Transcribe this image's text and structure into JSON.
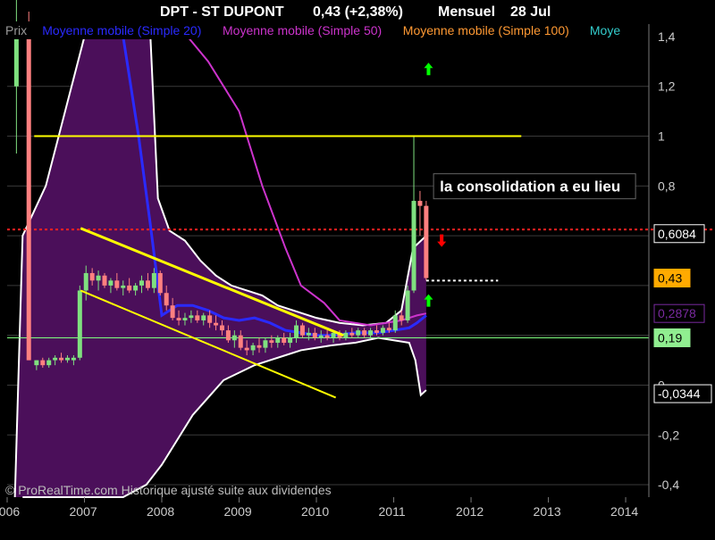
{
  "header": {
    "ticker": "DPT - ST DUPONT",
    "change": "0,43 (+2,38%)",
    "period": "Mensuel",
    "date": "28 Jul"
  },
  "legend": [
    {
      "label": "Prix",
      "color": "#9a9a9a"
    },
    {
      "label": "Moyenne mobile (Simple 20)",
      "color": "#2a2aff"
    },
    {
      "label": "Moyenne mobile (Simple 50)",
      "color": "#cc33cc"
    },
    {
      "label": "Moyenne mobile (Simple 100)",
      "color": "#ff9933"
    },
    {
      "label": "Moye",
      "color": "#33cccc"
    }
  ],
  "annotation": "la consolidation a eu lieu",
  "watermark": "© ProRealTime.com Historique ajusté suite aux dividendes",
  "price_tags": [
    {
      "text": "0,6084",
      "value": 0.6084,
      "bg": "#000000",
      "fg": "#ffffff",
      "border": "#ffffff"
    },
    {
      "text": "0,43",
      "value": 0.43,
      "bg": "#ffaa00",
      "fg": "#000000",
      "border": "#ffaa00"
    },
    {
      "text": "0,2878",
      "value": 0.2878,
      "bg": "#000000",
      "fg": "#7a2aa0",
      "border": "#7a2aa0"
    },
    {
      "text": "0,19",
      "value": 0.19,
      "bg": "#90ee90",
      "fg": "#000000",
      "border": "#90ee90"
    },
    {
      "text": "-0,0344",
      "value": -0.0344,
      "bg": "#000000",
      "fg": "#ffffff",
      "border": "#ffffff"
    }
  ],
  "colors": {
    "background": "#000000",
    "band_fill": "#4b0f5a",
    "band_edge": "#ffffff",
    "up_candle": "#7fe07f",
    "down_candle": "#ff8080",
    "trend_line": "#ffff00",
    "resistance": "#ff2020",
    "sma20": "#2a2aff",
    "sma50": "#cc33cc",
    "sma100_zone": "#ffffff",
    "support": "#80ff80",
    "arrow_up": "#00ff00",
    "arrow_down": "#ff0000",
    "axis_text": "#cccccc"
  },
  "chart_data": {
    "type": "candlestick",
    "title": "DPT - ST DUPONT",
    "ylim": [
      -0.45,
      1.45
    ],
    "xlim": [
      2006.0,
      2014.3
    ],
    "y_ticks": [
      {
        "v": 1.4,
        "label": "1,4"
      },
      {
        "v": 1.2,
        "label": "1,2"
      },
      {
        "v": 1.0,
        "label": "1"
      },
      {
        "v": 0.8,
        "label": "0,8"
      },
      {
        "v": 0.6,
        "label": ""
      },
      {
        "v": 0.4,
        "label": ""
      },
      {
        "v": 0.2,
        "label": ""
      },
      {
        "v": 0.0,
        "label": "0"
      },
      {
        "v": -0.2,
        "label": "-0,2"
      },
      {
        "v": -0.4,
        "label": "-0,4"
      }
    ],
    "x_ticks": [
      {
        "v": 2006.0,
        "label": "2006"
      },
      {
        "v": 2007.0,
        "label": "2007"
      },
      {
        "v": 2008.0,
        "label": "2008"
      },
      {
        "v": 2009.0,
        "label": "2009"
      },
      {
        "v": 2010.0,
        "label": "2010"
      },
      {
        "v": 2011.0,
        "label": "2011"
      },
      {
        "v": 2012.0,
        "label": "2012"
      },
      {
        "v": 2013.0,
        "label": "2013"
      },
      {
        "v": 2014.0,
        "label": "2014"
      }
    ],
    "candles": [
      {
        "x": 2006.12,
        "o": 1.2,
        "h": 1.7,
        "l": 0.93,
        "c": 1.45
      },
      {
        "x": 2006.28,
        "o": 1.4,
        "h": 1.5,
        "l": 0.1,
        "c": 0.1
      },
      {
        "x": 2006.38,
        "o": 0.08,
        "h": 0.1,
        "l": 0.06,
        "c": 0.1
      },
      {
        "x": 2006.46,
        "o": 0.1,
        "h": 0.11,
        "l": 0.07,
        "c": 0.08
      },
      {
        "x": 2006.54,
        "o": 0.08,
        "h": 0.11,
        "l": 0.07,
        "c": 0.1
      },
      {
        "x": 2006.62,
        "o": 0.1,
        "h": 0.12,
        "l": 0.08,
        "c": 0.11
      },
      {
        "x": 2006.7,
        "o": 0.11,
        "h": 0.13,
        "l": 0.09,
        "c": 0.1
      },
      {
        "x": 2006.78,
        "o": 0.1,
        "h": 0.12,
        "l": 0.09,
        "c": 0.11
      },
      {
        "x": 2006.86,
        "o": 0.1,
        "h": 0.12,
        "l": 0.08,
        "c": 0.11
      },
      {
        "x": 2006.94,
        "o": 0.11,
        "h": 0.4,
        "l": 0.1,
        "c": 0.38
      },
      {
        "x": 2007.02,
        "o": 0.38,
        "h": 0.48,
        "l": 0.34,
        "c": 0.45
      },
      {
        "x": 2007.1,
        "o": 0.45,
        "h": 0.47,
        "l": 0.4,
        "c": 0.42
      },
      {
        "x": 2007.18,
        "o": 0.42,
        "h": 0.46,
        "l": 0.38,
        "c": 0.44
      },
      {
        "x": 2007.26,
        "o": 0.44,
        "h": 0.45,
        "l": 0.39,
        "c": 0.4
      },
      {
        "x": 2007.34,
        "o": 0.4,
        "h": 0.43,
        "l": 0.37,
        "c": 0.42
      },
      {
        "x": 2007.42,
        "o": 0.42,
        "h": 0.45,
        "l": 0.38,
        "c": 0.39
      },
      {
        "x": 2007.5,
        "o": 0.39,
        "h": 0.42,
        "l": 0.36,
        "c": 0.4
      },
      {
        "x": 2007.58,
        "o": 0.4,
        "h": 0.43,
        "l": 0.37,
        "c": 0.38
      },
      {
        "x": 2007.66,
        "o": 0.38,
        "h": 0.41,
        "l": 0.36,
        "c": 0.4
      },
      {
        "x": 2007.74,
        "o": 0.4,
        "h": 0.44,
        "l": 0.37,
        "c": 0.42
      },
      {
        "x": 2007.82,
        "o": 0.42,
        "h": 0.45,
        "l": 0.38,
        "c": 0.39
      },
      {
        "x": 2007.9,
        "o": 0.39,
        "h": 0.47,
        "l": 0.37,
        "c": 0.45
      },
      {
        "x": 2007.98,
        "o": 0.45,
        "h": 0.46,
        "l": 0.36,
        "c": 0.37
      },
      {
        "x": 2008.06,
        "o": 0.37,
        "h": 0.4,
        "l": 0.3,
        "c": 0.32
      },
      {
        "x": 2008.14,
        "o": 0.32,
        "h": 0.35,
        "l": 0.26,
        "c": 0.27
      },
      {
        "x": 2008.22,
        "o": 0.27,
        "h": 0.3,
        "l": 0.24,
        "c": 0.26
      },
      {
        "x": 2008.3,
        "o": 0.26,
        "h": 0.29,
        "l": 0.24,
        "c": 0.27
      },
      {
        "x": 2008.38,
        "o": 0.27,
        "h": 0.3,
        "l": 0.25,
        "c": 0.28
      },
      {
        "x": 2008.46,
        "o": 0.28,
        "h": 0.3,
        "l": 0.25,
        "c": 0.26
      },
      {
        "x": 2008.54,
        "o": 0.26,
        "h": 0.29,
        "l": 0.24,
        "c": 0.28
      },
      {
        "x": 2008.62,
        "o": 0.28,
        "h": 0.3,
        "l": 0.23,
        "c": 0.25
      },
      {
        "x": 2008.7,
        "o": 0.25,
        "h": 0.28,
        "l": 0.22,
        "c": 0.24
      },
      {
        "x": 2008.78,
        "o": 0.24,
        "h": 0.26,
        "l": 0.2,
        "c": 0.22
      },
      {
        "x": 2008.86,
        "o": 0.22,
        "h": 0.24,
        "l": 0.17,
        "c": 0.18
      },
      {
        "x": 2008.94,
        "o": 0.18,
        "h": 0.22,
        "l": 0.15,
        "c": 0.2
      },
      {
        "x": 2009.02,
        "o": 0.2,
        "h": 0.22,
        "l": 0.14,
        "c": 0.15
      },
      {
        "x": 2009.1,
        "o": 0.15,
        "h": 0.18,
        "l": 0.12,
        "c": 0.14
      },
      {
        "x": 2009.18,
        "o": 0.14,
        "h": 0.17,
        "l": 0.12,
        "c": 0.16
      },
      {
        "x": 2009.26,
        "o": 0.16,
        "h": 0.19,
        "l": 0.13,
        "c": 0.15
      },
      {
        "x": 2009.34,
        "o": 0.15,
        "h": 0.19,
        "l": 0.13,
        "c": 0.18
      },
      {
        "x": 2009.42,
        "o": 0.18,
        "h": 0.2,
        "l": 0.15,
        "c": 0.17
      },
      {
        "x": 2009.5,
        "o": 0.17,
        "h": 0.2,
        "l": 0.15,
        "c": 0.19
      },
      {
        "x": 2009.58,
        "o": 0.19,
        "h": 0.21,
        "l": 0.16,
        "c": 0.17
      },
      {
        "x": 2009.66,
        "o": 0.17,
        "h": 0.21,
        "l": 0.15,
        "c": 0.19
      },
      {
        "x": 2009.74,
        "o": 0.19,
        "h": 0.26,
        "l": 0.17,
        "c": 0.24
      },
      {
        "x": 2009.82,
        "o": 0.24,
        "h": 0.25,
        "l": 0.19,
        "c": 0.2
      },
      {
        "x": 2009.9,
        "o": 0.2,
        "h": 0.23,
        "l": 0.18,
        "c": 0.21
      },
      {
        "x": 2009.98,
        "o": 0.21,
        "h": 0.23,
        "l": 0.18,
        "c": 0.19
      },
      {
        "x": 2010.06,
        "o": 0.19,
        "h": 0.22,
        "l": 0.17,
        "c": 0.2
      },
      {
        "x": 2010.14,
        "o": 0.2,
        "h": 0.22,
        "l": 0.18,
        "c": 0.19
      },
      {
        "x": 2010.22,
        "o": 0.19,
        "h": 0.22,
        "l": 0.17,
        "c": 0.21
      },
      {
        "x": 2010.3,
        "o": 0.21,
        "h": 0.22,
        "l": 0.18,
        "c": 0.19
      },
      {
        "x": 2010.38,
        "o": 0.19,
        "h": 0.22,
        "l": 0.18,
        "c": 0.21
      },
      {
        "x": 2010.46,
        "o": 0.21,
        "h": 0.23,
        "l": 0.19,
        "c": 0.2
      },
      {
        "x": 2010.54,
        "o": 0.2,
        "h": 0.23,
        "l": 0.19,
        "c": 0.22
      },
      {
        "x": 2010.62,
        "o": 0.22,
        "h": 0.23,
        "l": 0.19,
        "c": 0.2
      },
      {
        "x": 2010.7,
        "o": 0.2,
        "h": 0.23,
        "l": 0.19,
        "c": 0.22
      },
      {
        "x": 2010.78,
        "o": 0.22,
        "h": 0.24,
        "l": 0.2,
        "c": 0.21
      },
      {
        "x": 2010.86,
        "o": 0.21,
        "h": 0.24,
        "l": 0.2,
        "c": 0.23
      },
      {
        "x": 2010.94,
        "o": 0.23,
        "h": 0.25,
        "l": 0.21,
        "c": 0.22
      },
      {
        "x": 2011.02,
        "o": 0.22,
        "h": 0.3,
        "l": 0.21,
        "c": 0.28
      },
      {
        "x": 2011.1,
        "o": 0.28,
        "h": 0.3,
        "l": 0.24,
        "c": 0.26
      },
      {
        "x": 2011.18,
        "o": 0.26,
        "h": 0.4,
        "l": 0.25,
        "c": 0.38
      },
      {
        "x": 2011.26,
        "o": 0.38,
        "h": 1.0,
        "l": 0.37,
        "c": 0.74
      },
      {
        "x": 2011.34,
        "o": 0.74,
        "h": 0.78,
        "l": 0.6,
        "c": 0.72
      },
      {
        "x": 2011.42,
        "o": 0.72,
        "h": 0.74,
        "l": 0.42,
        "c": 0.43
      }
    ],
    "sma20": [
      [
        2007.5,
        1.4
      ],
      [
        2007.7,
        1.0
      ],
      [
        2007.85,
        0.65
      ],
      [
        2008.0,
        0.28
      ],
      [
        2008.2,
        0.32
      ],
      [
        2008.4,
        0.32
      ],
      [
        2008.6,
        0.3
      ],
      [
        2008.8,
        0.27
      ],
      [
        2009.0,
        0.26
      ],
      [
        2009.2,
        0.27
      ],
      [
        2009.4,
        0.25
      ],
      [
        2009.6,
        0.22
      ],
      [
        2009.8,
        0.21
      ],
      [
        2010.0,
        0.2
      ],
      [
        2010.2,
        0.2
      ],
      [
        2010.5,
        0.21
      ],
      [
        2010.8,
        0.21
      ],
      [
        2011.0,
        0.22
      ],
      [
        2011.2,
        0.23
      ],
      [
        2011.3,
        0.25
      ],
      [
        2011.42,
        0.28
      ]
    ],
    "sma50": [
      [
        2008.2,
        1.45
      ],
      [
        2008.6,
        1.3
      ],
      [
        2009.0,
        1.1
      ],
      [
        2009.3,
        0.8
      ],
      [
        2009.6,
        0.55
      ],
      [
        2009.8,
        0.4
      ],
      [
        2010.1,
        0.33
      ],
      [
        2010.3,
        0.26
      ],
      [
        2010.5,
        0.25
      ],
      [
        2010.7,
        0.24
      ],
      [
        2010.9,
        0.25
      ],
      [
        2011.1,
        0.26
      ],
      [
        2011.3,
        0.28
      ],
      [
        2011.42,
        0.2878
      ]
    ],
    "band_upper": [
      [
        2006.1,
        -0.45
      ],
      [
        2006.2,
        0.6
      ],
      [
        2006.5,
        0.8
      ],
      [
        2007.0,
        1.4
      ],
      [
        2007.5,
        1.45
      ],
      [
        2007.85,
        1.42
      ],
      [
        2007.95,
        0.75
      ],
      [
        2008.1,
        0.62
      ],
      [
        2008.3,
        0.58
      ],
      [
        2008.5,
        0.5
      ],
      [
        2008.7,
        0.44
      ],
      [
        2008.9,
        0.4
      ],
      [
        2009.1,
        0.38
      ],
      [
        2009.3,
        0.36
      ],
      [
        2009.5,
        0.32
      ],
      [
        2009.8,
        0.29
      ],
      [
        2010.0,
        0.27
      ],
      [
        2010.3,
        0.25
      ],
      [
        2010.6,
        0.24
      ],
      [
        2010.9,
        0.25
      ],
      [
        2011.1,
        0.3
      ],
      [
        2011.25,
        0.55
      ],
      [
        2011.42,
        0.6
      ]
    ],
    "band_lower": [
      [
        2011.42,
        -0.02
      ],
      [
        2011.35,
        -0.04
      ],
      [
        2011.28,
        0.1
      ],
      [
        2011.2,
        0.17
      ],
      [
        2011.0,
        0.18
      ],
      [
        2010.8,
        0.19
      ],
      [
        2010.5,
        0.17
      ],
      [
        2010.2,
        0.16
      ],
      [
        2010.0,
        0.15
      ],
      [
        2009.8,
        0.14
      ],
      [
        2009.6,
        0.12
      ],
      [
        2009.4,
        0.1
      ],
      [
        2009.2,
        0.08
      ],
      [
        2009.0,
        0.05
      ],
      [
        2008.8,
        0.02
      ],
      [
        2008.6,
        -0.05
      ],
      [
        2008.4,
        -0.12
      ],
      [
        2008.2,
        -0.22
      ],
      [
        2008.0,
        -0.32
      ],
      [
        2007.8,
        -0.4
      ],
      [
        2007.5,
        -0.45
      ],
      [
        2007.0,
        -0.45
      ],
      [
        2006.5,
        -0.45
      ],
      [
        2006.2,
        -0.45
      ]
    ],
    "trend_lines": [
      {
        "from": [
          2006.95,
          0.63
        ],
        "to": [
          2010.35,
          0.2
        ],
        "width": 3
      },
      {
        "from": [
          2006.95,
          0.38
        ],
        "to": [
          2010.25,
          -0.05
        ],
        "width": 2
      },
      {
        "from": [
          2006.35,
          1.0
        ],
        "to": [
          2012.65,
          1.0
        ],
        "width": 2
      }
    ],
    "resistance": 0.625,
    "support_line": 0.19,
    "white_dotted": {
      "from": 2011.42,
      "to": 2012.35,
      "v": 0.42
    },
    "arrows": [
      {
        "x": 2011.45,
        "v": 1.27,
        "dir": "up"
      },
      {
        "x": 2011.62,
        "v": 0.58,
        "dir": "down"
      },
      {
        "x": 2011.45,
        "v": 0.34,
        "dir": "up"
      }
    ],
    "annotation_anchor": {
      "x": 2011.55,
      "v": 0.77
    }
  }
}
